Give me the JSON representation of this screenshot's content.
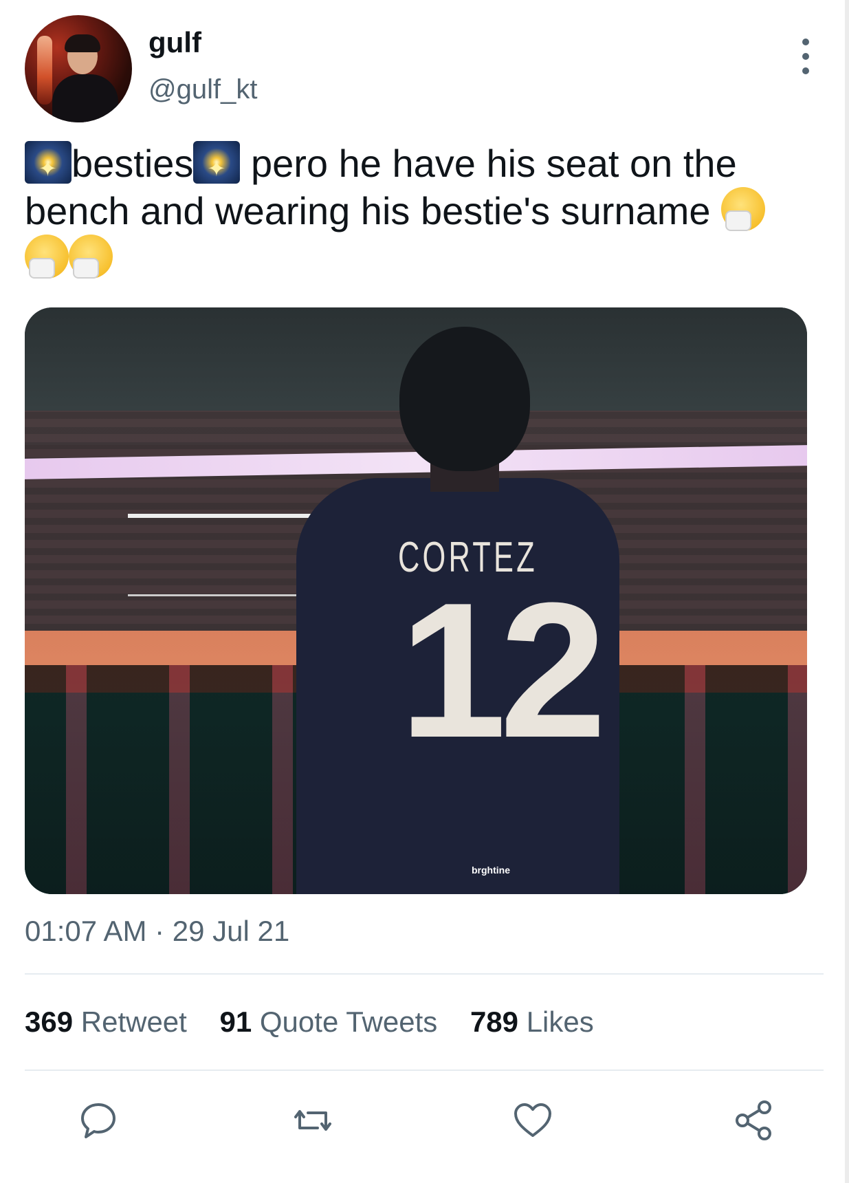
{
  "user": {
    "display_name": "gulf",
    "handle": "@gulf_kt"
  },
  "tweet": {
    "text_part1": "besties",
    "text_part2": " pero he have his seat on the bench and wearing his bestie's surname ",
    "emoji_sparkle": "fireworks-emoji",
    "emoji_sneeze": "sneezing-face-emoji"
  },
  "media": {
    "jersey_name": "CORTEZ",
    "jersey_number": "12",
    "watermark": "brghtine"
  },
  "timestamp": "01:07 AM · 29 Jul 21",
  "stats": {
    "retweets": {
      "count": "369",
      "label": "Retweet"
    },
    "quotes": {
      "count": "91",
      "label": "Quote Tweets"
    },
    "likes": {
      "count": "789",
      "label": "Likes"
    }
  },
  "actions": [
    "reply-icon",
    "retweet-icon",
    "like-icon",
    "share-icon"
  ],
  "colors": {
    "text": "#0f1419",
    "secondary": "#536471",
    "divider": "#e6ecf0"
  }
}
